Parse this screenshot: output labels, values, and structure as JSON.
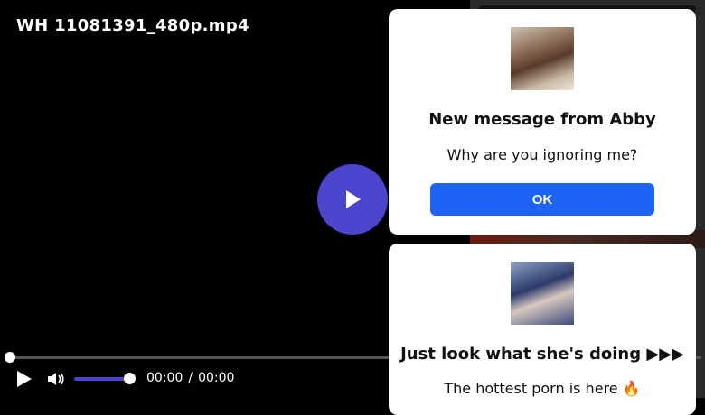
{
  "video": {
    "title": "WH 11081391_480p.mp4",
    "current_time": "00:00",
    "separator": "/",
    "duration": "00:00",
    "progress": 0,
    "volume": 1.0,
    "accent_color": "#4b44cc"
  },
  "icons": {
    "big_play": "play-icon",
    "play": "play-icon",
    "volume": "speaker-icon"
  },
  "popup1": {
    "title": "New message from Abby",
    "message": "Why are you ignoring me?",
    "button_label": "OK",
    "button_color": "#1f63f5"
  },
  "popup2": {
    "title": "Just look what she's doing ▶▶▶",
    "message": "The hottest porn is here 🔥"
  }
}
